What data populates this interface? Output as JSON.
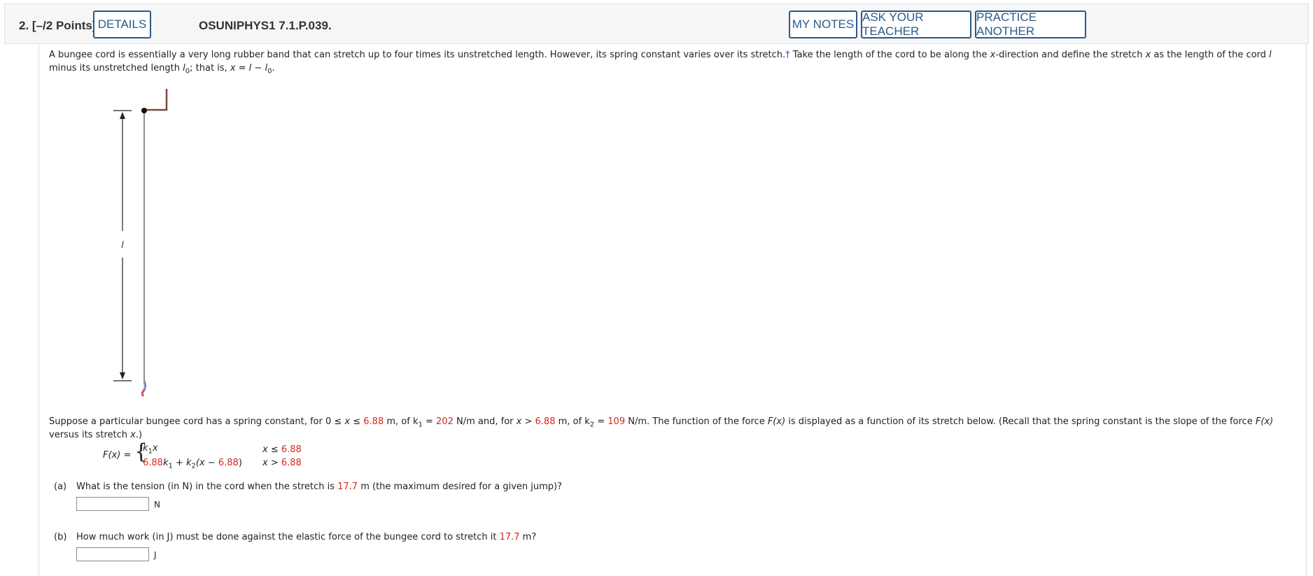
{
  "header": {
    "question_number": "2.",
    "points": "[–/2 Points]",
    "details_label": "DETAILS",
    "question_id": "OSUNIPHYS1 7.1.P.039.",
    "my_notes_label": "MY NOTES",
    "ask_teacher_label": "ASK YOUR TEACHER",
    "practice_label": "PRACTICE ANOTHER"
  },
  "intro": {
    "line1_a": "A bungee cord is essentially a very long rubber band that can stretch up to four times its unstretched length. However, its spring constant varies over its stretch.",
    "footnote": "†",
    "line1_b": " Take the length of the cord to be along the ",
    "x": "x",
    "line1_c": "-direction and define the stretch ",
    "line1_d": " as the length of the cord ",
    "l": "l",
    "line2_a": "minus its unstretched length ",
    "l0": "l",
    "sub0": "0",
    "line2_b": "; that is, ",
    "eq": "x = l − l",
    "line2_end": "."
  },
  "figure": {
    "label_l": "l"
  },
  "problem": {
    "p1": "Suppose a particular bungee cord has a spring constant, for 0 ≤ ",
    "p2": " ≤ ",
    "x_thresh": "6.88",
    "p3": " m, of k",
    "sub1": "1",
    "p4": " = ",
    "k1": "202",
    "p5": " N/m and, for ",
    "p6": " > ",
    "p7": " m, of k",
    "sub2": "2",
    "k2": "109",
    "p8": " N/m. The function of the force ",
    "Fx": "F(x)",
    "p9": " is displayed as a function of its stretch below. (Recall that the spring constant is the slope of the force ",
    "p9_end": "",
    "line2": "versus its stretch ",
    "line2_end": ".)"
  },
  "piecewise": {
    "lhs": "F(x) = ",
    "case1_expr": "k",
    "case1_sub": "1",
    "case1_x": "x",
    "case1_cond_a": "x ≤ ",
    "case2_a": "",
    "case2_k1": "k",
    "case2_sub1": "1",
    "case2_b": " + k",
    "case2_sub2": "2",
    "case2_c": "(x − ",
    "case2_d": ")",
    "case2_cond_a": "x > "
  },
  "part_a": {
    "label": "(a)",
    "q1": "What is the tension (in N) in the cord when the stretch is ",
    "value": "17.7",
    "q2": " m (the maximum desired for a given jump)?",
    "unit": "N",
    "input_value": ""
  },
  "part_b": {
    "label": "(b)",
    "q1": "How much work (in J) must be done against the elastic force of the bungee cord to stretch it ",
    "value": "17.7",
    "q2": " m?",
    "unit": "J",
    "input_value": ""
  },
  "colors": {
    "accent": "#2a5a8c",
    "highlight": "#d7261e",
    "cord_top": "#7a4a3a",
    "cord_end": "#c9565e"
  }
}
